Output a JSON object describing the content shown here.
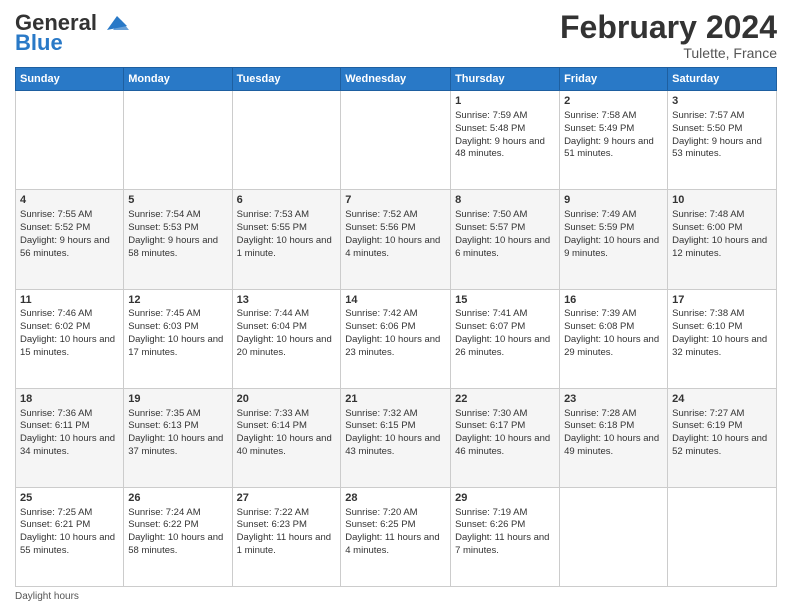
{
  "header": {
    "logo_general": "General",
    "logo_blue": "Blue",
    "month_title": "February 2024",
    "location": "Tulette, France"
  },
  "weekdays": [
    "Sunday",
    "Monday",
    "Tuesday",
    "Wednesday",
    "Thursday",
    "Friday",
    "Saturday"
  ],
  "weeks": [
    [
      {
        "day": "",
        "info": ""
      },
      {
        "day": "",
        "info": ""
      },
      {
        "day": "",
        "info": ""
      },
      {
        "day": "",
        "info": ""
      },
      {
        "day": "1",
        "info": "Sunrise: 7:59 AM\nSunset: 5:48 PM\nDaylight: 9 hours and 48 minutes."
      },
      {
        "day": "2",
        "info": "Sunrise: 7:58 AM\nSunset: 5:49 PM\nDaylight: 9 hours and 51 minutes."
      },
      {
        "day": "3",
        "info": "Sunrise: 7:57 AM\nSunset: 5:50 PM\nDaylight: 9 hours and 53 minutes."
      }
    ],
    [
      {
        "day": "4",
        "info": "Sunrise: 7:55 AM\nSunset: 5:52 PM\nDaylight: 9 hours and 56 minutes."
      },
      {
        "day": "5",
        "info": "Sunrise: 7:54 AM\nSunset: 5:53 PM\nDaylight: 9 hours and 58 minutes."
      },
      {
        "day": "6",
        "info": "Sunrise: 7:53 AM\nSunset: 5:55 PM\nDaylight: 10 hours and 1 minute."
      },
      {
        "day": "7",
        "info": "Sunrise: 7:52 AM\nSunset: 5:56 PM\nDaylight: 10 hours and 4 minutes."
      },
      {
        "day": "8",
        "info": "Sunrise: 7:50 AM\nSunset: 5:57 PM\nDaylight: 10 hours and 6 minutes."
      },
      {
        "day": "9",
        "info": "Sunrise: 7:49 AM\nSunset: 5:59 PM\nDaylight: 10 hours and 9 minutes."
      },
      {
        "day": "10",
        "info": "Sunrise: 7:48 AM\nSunset: 6:00 PM\nDaylight: 10 hours and 12 minutes."
      }
    ],
    [
      {
        "day": "11",
        "info": "Sunrise: 7:46 AM\nSunset: 6:02 PM\nDaylight: 10 hours and 15 minutes."
      },
      {
        "day": "12",
        "info": "Sunrise: 7:45 AM\nSunset: 6:03 PM\nDaylight: 10 hours and 17 minutes."
      },
      {
        "day": "13",
        "info": "Sunrise: 7:44 AM\nSunset: 6:04 PM\nDaylight: 10 hours and 20 minutes."
      },
      {
        "day": "14",
        "info": "Sunrise: 7:42 AM\nSunset: 6:06 PM\nDaylight: 10 hours and 23 minutes."
      },
      {
        "day": "15",
        "info": "Sunrise: 7:41 AM\nSunset: 6:07 PM\nDaylight: 10 hours and 26 minutes."
      },
      {
        "day": "16",
        "info": "Sunrise: 7:39 AM\nSunset: 6:08 PM\nDaylight: 10 hours and 29 minutes."
      },
      {
        "day": "17",
        "info": "Sunrise: 7:38 AM\nSunset: 6:10 PM\nDaylight: 10 hours and 32 minutes."
      }
    ],
    [
      {
        "day": "18",
        "info": "Sunrise: 7:36 AM\nSunset: 6:11 PM\nDaylight: 10 hours and 34 minutes."
      },
      {
        "day": "19",
        "info": "Sunrise: 7:35 AM\nSunset: 6:13 PM\nDaylight: 10 hours and 37 minutes."
      },
      {
        "day": "20",
        "info": "Sunrise: 7:33 AM\nSunset: 6:14 PM\nDaylight: 10 hours and 40 minutes."
      },
      {
        "day": "21",
        "info": "Sunrise: 7:32 AM\nSunset: 6:15 PM\nDaylight: 10 hours and 43 minutes."
      },
      {
        "day": "22",
        "info": "Sunrise: 7:30 AM\nSunset: 6:17 PM\nDaylight: 10 hours and 46 minutes."
      },
      {
        "day": "23",
        "info": "Sunrise: 7:28 AM\nSunset: 6:18 PM\nDaylight: 10 hours and 49 minutes."
      },
      {
        "day": "24",
        "info": "Sunrise: 7:27 AM\nSunset: 6:19 PM\nDaylight: 10 hours and 52 minutes."
      }
    ],
    [
      {
        "day": "25",
        "info": "Sunrise: 7:25 AM\nSunset: 6:21 PM\nDaylight: 10 hours and 55 minutes."
      },
      {
        "day": "26",
        "info": "Sunrise: 7:24 AM\nSunset: 6:22 PM\nDaylight: 10 hours and 58 minutes."
      },
      {
        "day": "27",
        "info": "Sunrise: 7:22 AM\nSunset: 6:23 PM\nDaylight: 11 hours and 1 minute."
      },
      {
        "day": "28",
        "info": "Sunrise: 7:20 AM\nSunset: 6:25 PM\nDaylight: 11 hours and 4 minutes."
      },
      {
        "day": "29",
        "info": "Sunrise: 7:19 AM\nSunset: 6:26 PM\nDaylight: 11 hours and 7 minutes."
      },
      {
        "day": "",
        "info": ""
      },
      {
        "day": "",
        "info": ""
      }
    ]
  ],
  "footer": {
    "daylight_label": "Daylight hours"
  }
}
